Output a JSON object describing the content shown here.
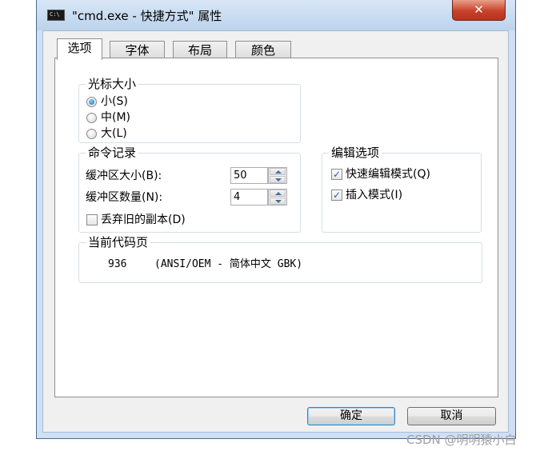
{
  "window": {
    "title": "\"cmd.exe - 快捷方式\" 属性",
    "close_glyph": "✕"
  },
  "tabs": [
    {
      "label": "选项",
      "active": true
    },
    {
      "label": "字体",
      "active": false
    },
    {
      "label": "布局",
      "active": false
    },
    {
      "label": "颜色",
      "active": false
    }
  ],
  "cursor_size": {
    "legend": "光标大小",
    "options": [
      {
        "label": "小(S)",
        "selected": true
      },
      {
        "label": "中(M)",
        "selected": false
      },
      {
        "label": "大(L)",
        "selected": false
      }
    ]
  },
  "command_history": {
    "legend": "命令记录",
    "buffer_size_label": "缓冲区大小(B):",
    "buffer_size_value": "50",
    "buffer_count_label": "缓冲区数量(N):",
    "buffer_count_value": "4",
    "discard_old_label": "丢弃旧的副本(D)",
    "discard_old_checked": false
  },
  "edit_options": {
    "legend": "编辑选项",
    "quick_edit_label": "快速编辑模式(Q)",
    "quick_edit_checked": true,
    "insert_mode_label": "插入模式(I)",
    "insert_mode_checked": true
  },
  "code_page": {
    "legend": "当前代码页",
    "number": "936",
    "description": "(ANSI/OEM - 简体中文 GBK)"
  },
  "buttons": {
    "ok": "确定",
    "cancel": "取消"
  },
  "watermark": "CSDN @明明猿小白",
  "check_glyph": "✓"
}
